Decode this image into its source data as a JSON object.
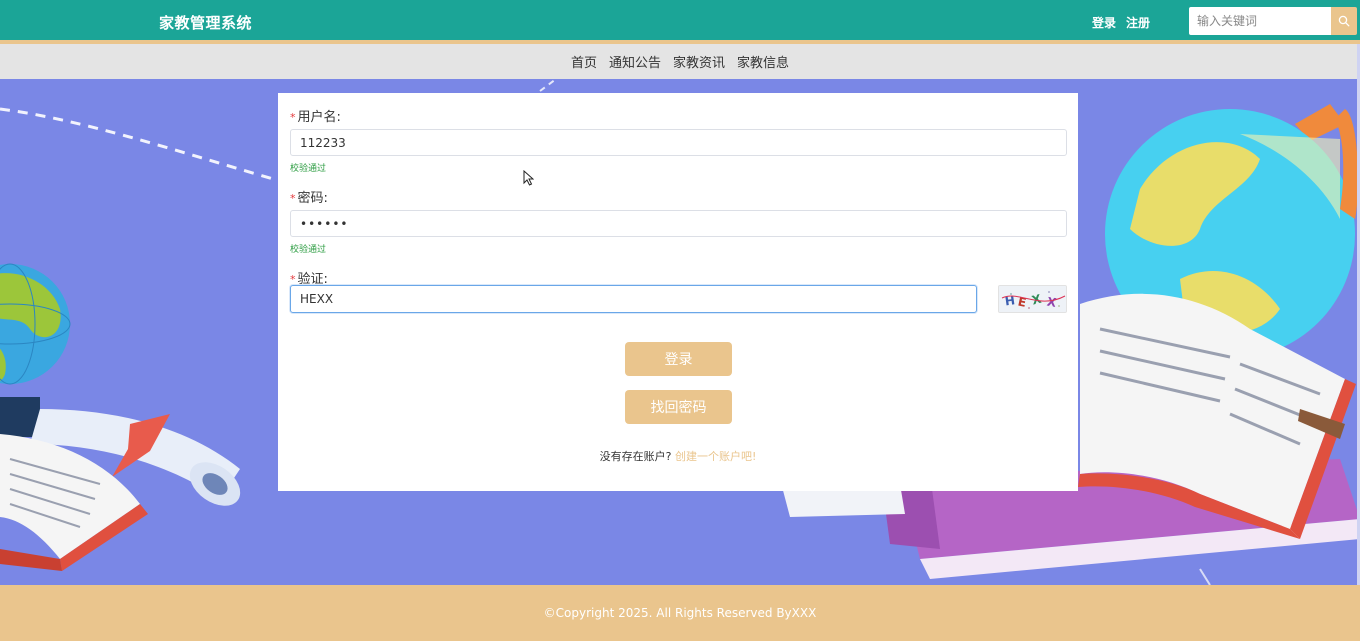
{
  "header": {
    "brand": "家教管理系统",
    "login": "登录",
    "register": "注册",
    "search_placeholder": "输入关键词"
  },
  "nav": {
    "items": [
      "首页",
      "通知公告",
      "家教资讯",
      "家教信息"
    ]
  },
  "form": {
    "username": {
      "label": "用户名:",
      "value": "112233",
      "hint": "校验通过"
    },
    "password": {
      "label": "密码:",
      "value": "••••••",
      "hint": "校验通过"
    },
    "captcha": {
      "label": "验证:",
      "value": "HEXX",
      "image_text": "HEXX"
    },
    "login_button": "登录",
    "recover_button": "找回密码",
    "no_account": "没有存在账户?",
    "create_link": "创建一个账户吧!"
  },
  "footer": {
    "copyright": "©Copyright 2025. All Rights Reserved ByXXX"
  },
  "colors": {
    "primary": "#1ba597",
    "accent": "#eac58d",
    "hero_bg": "#7a87e6",
    "nav_bg": "#e4e4e4"
  }
}
